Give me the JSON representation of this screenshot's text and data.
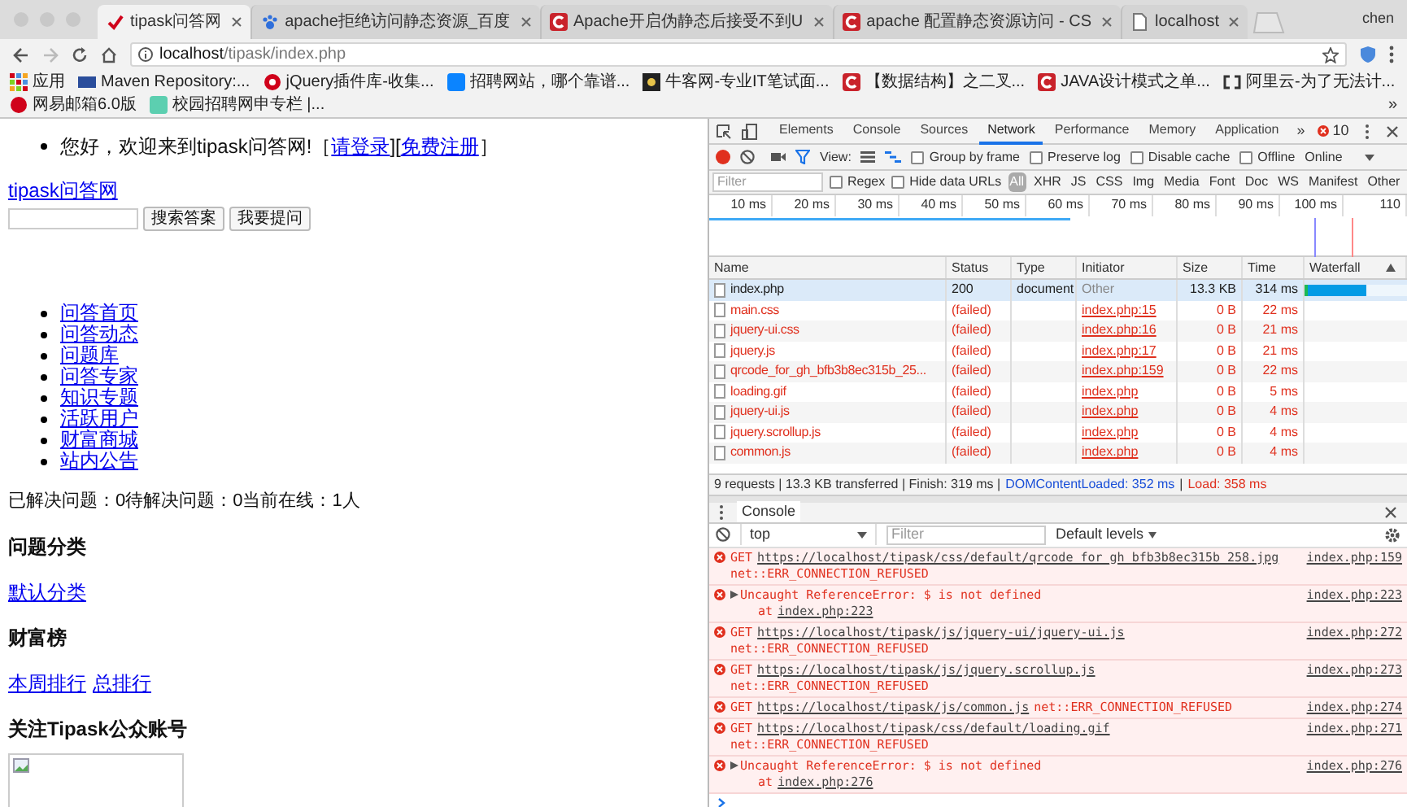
{
  "browser": {
    "tabs": [
      {
        "title": "tipask问答网",
        "selected": true
      },
      {
        "title": "apache拒绝访问静态资源_百度",
        "selected": false
      },
      {
        "title": "Apache开启伪静态后接受不到U",
        "selected": false
      },
      {
        "title": "apache 配置静态资源访问 - CS",
        "selected": false
      },
      {
        "title": "localhost",
        "selected": false
      }
    ],
    "user": "chen",
    "address": {
      "host": "localhost",
      "path": "/tipask/index.php"
    },
    "bookmarks": [
      "应用",
      "Maven Repository:...",
      "jQuery插件库-收集...",
      "招聘网站，哪个靠谱...",
      "牛客网-专业IT笔试面...",
      "【数据结构】之二叉...",
      "JAVA设计模式之单...",
      "阿里云-为了无法计...",
      "网易邮箱6.0版",
      "校园招聘网申专栏 |..."
    ],
    "more_bookmarks": "»"
  },
  "page": {
    "greeting": [
      {
        "kind": "text",
        "text": "您好，欢迎来到tipask问答网!［"
      },
      {
        "kind": "link",
        "text": "请登录"
      },
      {
        "kind": "text",
        "text": "]["
      },
      {
        "kind": "link",
        "text": "免费注册"
      },
      {
        "kind": "text",
        "text": "］"
      }
    ],
    "site_link": "tipask问答网",
    "buttons": [
      "搜索答案",
      "我要提问"
    ],
    "nav": [
      "问答首页",
      "问答动态",
      "问题库",
      "问答专家",
      "知识专题",
      "活跃用户",
      "财富商城",
      "站内公告"
    ],
    "stats": "已解决问题：0待解决问题：0当前在线：1人",
    "sections": [
      {
        "kind": "links",
        "heading": "问题分类",
        "links": [
          "默认分类"
        ]
      },
      {
        "kind": "links",
        "heading": "财富榜",
        "links": [
          "本周排行",
          "总排行"
        ]
      },
      {
        "kind": "image",
        "heading": "关注Tipask公众账号"
      }
    ]
  },
  "devtools": {
    "tabs": [
      {
        "label": "Elements",
        "selected": false
      },
      {
        "label": "Console",
        "selected": false
      },
      {
        "label": "Sources",
        "selected": false
      },
      {
        "label": "Network",
        "selected": true
      },
      {
        "label": "Performance",
        "selected": false
      },
      {
        "label": "Memory",
        "selected": false
      },
      {
        "label": "Application",
        "selected": false
      }
    ],
    "more_tabs": "»",
    "error_count": "10",
    "toolbar": {
      "recording": true,
      "filter_active": true,
      "view_label": "View:",
      "checkboxes": [
        {
          "label": "Group by frame",
          "checked": false
        },
        {
          "label": "Preserve log",
          "checked": false
        },
        {
          "label": "Disable cache",
          "checked": false
        },
        {
          "label": "Offline",
          "checked": false
        }
      ],
      "throttle": "Online"
    },
    "filter": {
      "placeholder": "Filter",
      "checkboxes": [
        {
          "label": "Regex",
          "checked": false
        },
        {
          "label": "Hide data URLs",
          "checked": false
        }
      ],
      "types": [
        {
          "label": "All",
          "selected": true
        },
        {
          "label": "XHR",
          "selected": false
        },
        {
          "label": "JS",
          "selected": false
        },
        {
          "label": "CSS",
          "selected": false
        },
        {
          "label": "Img",
          "selected": false
        },
        {
          "label": "Media",
          "selected": false
        },
        {
          "label": "Font",
          "selected": false
        },
        {
          "label": "Doc",
          "selected": false
        },
        {
          "label": "WS",
          "selected": false
        },
        {
          "label": "Manifest",
          "selected": false
        },
        {
          "label": "Other",
          "selected": false
        }
      ]
    },
    "timeline_ticks": [
      "10 ms",
      "20 ms",
      "30 ms",
      "40 ms",
      "50 ms",
      "60 ms",
      "70 ms",
      "80 ms",
      "90 ms",
      "100 ms",
      "110"
    ],
    "table": {
      "columns": [
        "Name",
        "Status",
        "Type",
        "Initiator",
        "Size",
        "Time",
        "Waterfall"
      ],
      "rows": [
        {
          "name": "index.php",
          "status": "200",
          "type": "document",
          "initiator": "Other",
          "size": "13.3 KB",
          "time": "314 ms",
          "failed": false,
          "selected": true,
          "level": 0.6
        },
        {
          "name": "main.css",
          "status": "(failed)",
          "initiator": "index.php:15",
          "size": "0 B",
          "time": "22 ms",
          "failed": true,
          "selected": false
        },
        {
          "name": "jquery-ui.css",
          "status": "(failed)",
          "initiator": "index.php:16",
          "size": "0 B",
          "time": "21 ms",
          "failed": true,
          "selected": false
        },
        {
          "name": "jquery.js",
          "status": "(failed)",
          "initiator": "index.php:17",
          "size": "0 B",
          "time": "21 ms",
          "failed": true,
          "selected": false
        },
        {
          "name": "qrcode_for_gh_bfb3b8ec315b_25...",
          "status": "(failed)",
          "initiator": "index.php:159",
          "size": "0 B",
          "time": "22 ms",
          "failed": true,
          "selected": false
        },
        {
          "name": "loading.gif",
          "status": "(failed)",
          "initiator": "index.php",
          "size": "0 B",
          "time": "5 ms",
          "failed": true,
          "selected": false
        },
        {
          "name": "jquery-ui.js",
          "status": "(failed)",
          "initiator": "index.php",
          "size": "0 B",
          "time": "4 ms",
          "failed": true,
          "selected": false
        },
        {
          "name": "jquery.scrollup.js",
          "status": "(failed)",
          "initiator": "index.php",
          "size": "0 B",
          "time": "4 ms",
          "failed": true,
          "selected": false
        },
        {
          "name": "common.js",
          "status": "(failed)",
          "initiator": "index.php",
          "size": "0 B",
          "time": "4 ms",
          "failed": true,
          "selected": false
        }
      ]
    },
    "summary": {
      "text": "9 requests | 13.3 KB transferred | Finish: 319 ms |",
      "dom_content_loaded": "DOMContentLoaded: 352 ms",
      "separator": "|",
      "load": "Load: 358 ms"
    },
    "drawer": {
      "tab": "Console",
      "context": "top",
      "filter_placeholder": "Filter",
      "levels": "Default levels",
      "messages": [
        {
          "kind": "network",
          "method": "GET",
          "url": "https://localhost/tipask/css/default/qrcode_for_gh_bfb3b8ec315b_258.jpg",
          "error": "net::ERR_CONNECTION_REFUSED",
          "inline": false,
          "source": "index.php:159"
        },
        {
          "kind": "exception",
          "text": "Uncaught ReferenceError: $ is not defined",
          "at": "at",
          "at_link": "index.php:223",
          "expanded": false,
          "source": "index.php:223"
        },
        {
          "kind": "network",
          "method": "GET",
          "url": "https://localhost/tipask/js/jquery-ui/jquery-ui.js",
          "error": "net::ERR_CONNECTION_REFUSED",
          "inline": false,
          "source": "index.php:272"
        },
        {
          "kind": "network",
          "method": "GET",
          "url": "https://localhost/tipask/js/jquery.scrollup.js",
          "error": "net::ERR_CONNECTION_REFUSED",
          "inline": false,
          "source": "index.php:273"
        },
        {
          "kind": "network",
          "method": "GET",
          "url": "https://localhost/tipask/js/common.js",
          "error": "net::ERR_CONNECTION_REFUSED",
          "inline": true,
          "source": "index.php:274"
        },
        {
          "kind": "network",
          "method": "GET",
          "url": "https://localhost/tipask/css/default/loading.gif",
          "error": "net::ERR_CONNECTION_REFUSED",
          "inline": false,
          "source": "index.php:271"
        },
        {
          "kind": "exception",
          "text": "Uncaught ReferenceError: $ is not defined",
          "at": "at",
          "at_link": "index.php:276",
          "expanded": false,
          "source": "index.php:276"
        }
      ]
    }
  }
}
